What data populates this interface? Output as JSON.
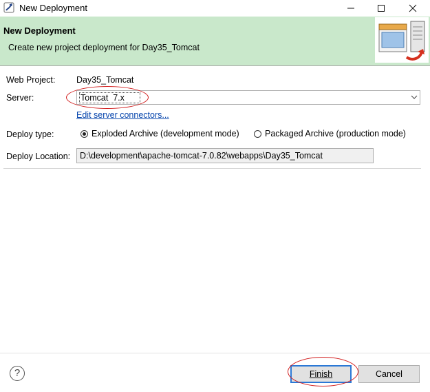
{
  "window": {
    "title": "New Deployment",
    "controls": {
      "minimize": "minimize",
      "maximize": "maximize",
      "close": "close"
    }
  },
  "banner": {
    "title": "New Deployment",
    "description": "Create new project deployment for Day35_Tomcat",
    "image_icon": "server-deploy-icon"
  },
  "form": {
    "web_project": {
      "label": "Web Project:",
      "value": "Day35_Tomcat"
    },
    "server": {
      "label": "Server:",
      "value": "Tomcat  7.x"
    },
    "edit_link": "Edit server connectors...",
    "deploy_type": {
      "label": "Deploy type:",
      "options": [
        {
          "label": "Exploded Archive (development mode)",
          "selected": true
        },
        {
          "label": "Packaged Archive (production mode)",
          "selected": false
        }
      ]
    },
    "deploy_location": {
      "label": "Deploy Location:",
      "value": "D:\\development\\apache-tomcat-7.0.82\\webapps\\Day35_Tomcat"
    }
  },
  "footer": {
    "help_icon": "help-icon",
    "finish_label": "Finish",
    "cancel_label": "Cancel"
  },
  "colors": {
    "banner_bg": "#c9e8cb",
    "annotation_red": "#d21f1f",
    "link_blue": "#0645ad",
    "default_button_border": "#2a78d6"
  }
}
